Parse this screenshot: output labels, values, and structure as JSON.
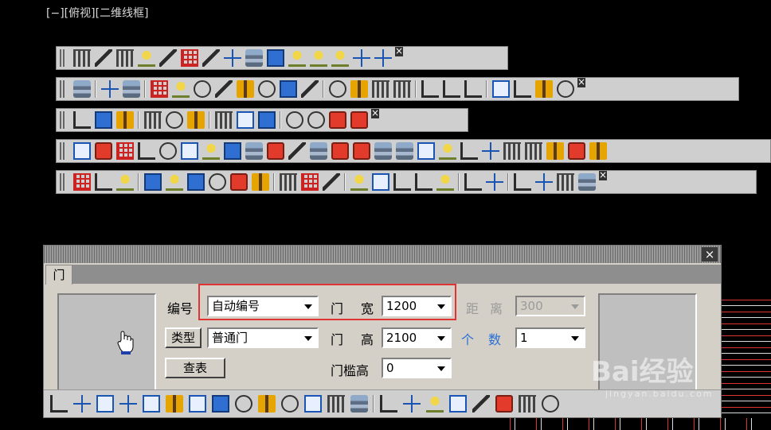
{
  "viewport_title": "[−][俯视][二维线框]",
  "toolbars": [
    {
      "name": "layer-toolbar",
      "icons": [
        "layers-icon",
        "layer-previous-icon",
        "bulb-icon",
        "bulb-on-icon",
        "bulb-yellow-icon",
        "sun-icon",
        "snowflake-icon",
        "snowflake-outline-icon",
        "sun-outline-icon",
        "lock-icon",
        "lock-outline-icon",
        "lock-yellow-icon",
        "layer-walk-icon",
        "layer-merge-icon",
        "layer-edit-icon"
      ]
    },
    {
      "name": "tool-toolbar",
      "icons": [
        "monitor-icon",
        "zoom-window-icon",
        "table-icon",
        "frame-icon",
        "leader-icon",
        "dimension-icon",
        "arrow-dim-icon",
        "elevation-icon",
        "text-a-icon",
        "copy-icon",
        "level-icon",
        "abc-icon",
        "grid-icon",
        "ruler-icon",
        "arch-icon",
        "building-icon",
        "eye-red-icon",
        "pencil-icon",
        "eye-icon",
        "tile-icon",
        "viewport-icon",
        "broom-icon"
      ]
    },
    {
      "name": "window-toolbar",
      "icons": [
        "window-copy-icon",
        "window-paste-icon",
        "window-cascade-icon",
        "window-minimize-icon",
        "align-left-icon",
        "align-right-icon",
        "align-center-icon",
        "distribute-top-icon",
        "distribute-bottom-icon",
        "distribute-middle-icon",
        "list-icon",
        "column-icon",
        "hatch-icon"
      ]
    },
    {
      "name": "arch-toolbar",
      "icons": [
        "axis-grid-icon",
        "edit-icon",
        "layers-icon",
        "grid-red-icon",
        "column-red-icon",
        "wall-icon",
        "door-icon",
        "window-icon",
        "window-blue-icon",
        "arc-door-icon",
        "stair-icon",
        "elevator-icon",
        "shaft-icon",
        "gate-icon",
        "panel-icon",
        "mail-icon",
        "stamp-icon",
        "brush-icon",
        "shell-icon",
        "frame-icon",
        "level-mark-icon",
        "elevation-icon",
        "text-a-icon",
        "target-icon",
        "help-icon"
      ]
    },
    {
      "name": "dim-toolbar",
      "icons": [
        "grid-red-icon",
        "column-red-icon",
        "wall-end-icon",
        "wall-curve-icon",
        "dim-up-icon",
        "dim-door-icon",
        "dim-wall-icon",
        "dim-window-icon",
        "arc-door-icon",
        "door-blue-icon",
        "text-style-icon",
        "text-icon",
        "text-table-icon",
        "dim-axis-icon",
        "dim-chain-icon",
        "dim-step-icon",
        "rotate-icon",
        "mirror-icon",
        "offset-icon",
        "link-icon",
        "move-icon",
        "move-blue-icon",
        "clipboard-icon"
      ]
    }
  ],
  "dialog": {
    "tab_label": "门",
    "close": "×",
    "labels": {
      "number": "编号",
      "door1": "门",
      "width": "宽",
      "distance": "距",
      "distance2": "离",
      "door2": "门",
      "height": "高",
      "count1": "个",
      "count2": "数",
      "sill_height": "门槛高"
    },
    "buttons": {
      "type": "类型",
      "lookup": "查表"
    },
    "fields": {
      "number": "自动编号",
      "width": "1200",
      "distance": "300",
      "type": "普通门",
      "height": "2100",
      "count": "1",
      "sill_height": "0"
    },
    "bottom_icons": [
      "door-insert-icon",
      "window-line-icon",
      "dim-mid-icon",
      "door-elev-icon",
      "swing-icon",
      "axis-offset-icon",
      "arc-icon",
      "symbol-icon",
      "portal-icon",
      "balcony-icon",
      "flip-icon",
      "pencil-red-icon",
      "picker-icon",
      "eraser-icon",
      "door-leaf-icon",
      "grid-blue-icon",
      "corner-icon",
      "wave-icon",
      "arch-open-icon",
      "window-box-icon",
      "bay-window-icon",
      "table-icon"
    ]
  },
  "watermark": {
    "main": "Bai经验",
    "sub": "jingyan.baidu.com"
  }
}
